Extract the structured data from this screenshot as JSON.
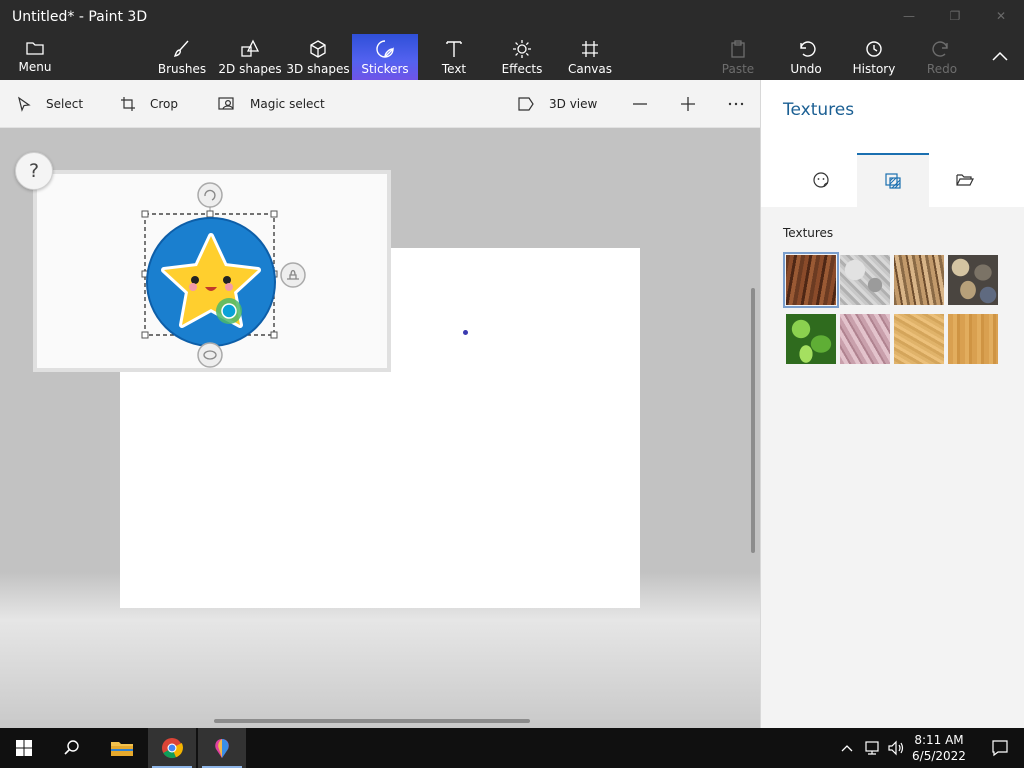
{
  "window": {
    "title": "Untitled* - Paint 3D"
  },
  "ribbon": {
    "menu": "Menu",
    "brushes": "Brushes",
    "shapes2d": "2D shapes",
    "shapes3d": "3D shapes",
    "stickers": "Stickers",
    "text": "Text",
    "effects": "Effects",
    "canvas": "Canvas",
    "paste": "Paste",
    "undo": "Undo",
    "history": "History",
    "redo": "Redo",
    "active_color": "#4a5ae8"
  },
  "toolbar": {
    "select": "Select",
    "crop": "Crop",
    "magic_select": "Magic select",
    "view3d": "3D view"
  },
  "canvas": {
    "help": "?"
  },
  "panel": {
    "title": "Textures",
    "section_label": "Textures",
    "textures": [
      "bark",
      "granite",
      "wood-grain",
      "pebbles",
      "leaves",
      "pink-marble",
      "sand",
      "light-wood"
    ],
    "selected_texture": "bark"
  },
  "taskbar": {
    "time": "8:11 AM",
    "date": "6/5/2022"
  },
  "colors": {
    "accent": "#1a6fb0",
    "title_text": "#1b5f93"
  }
}
